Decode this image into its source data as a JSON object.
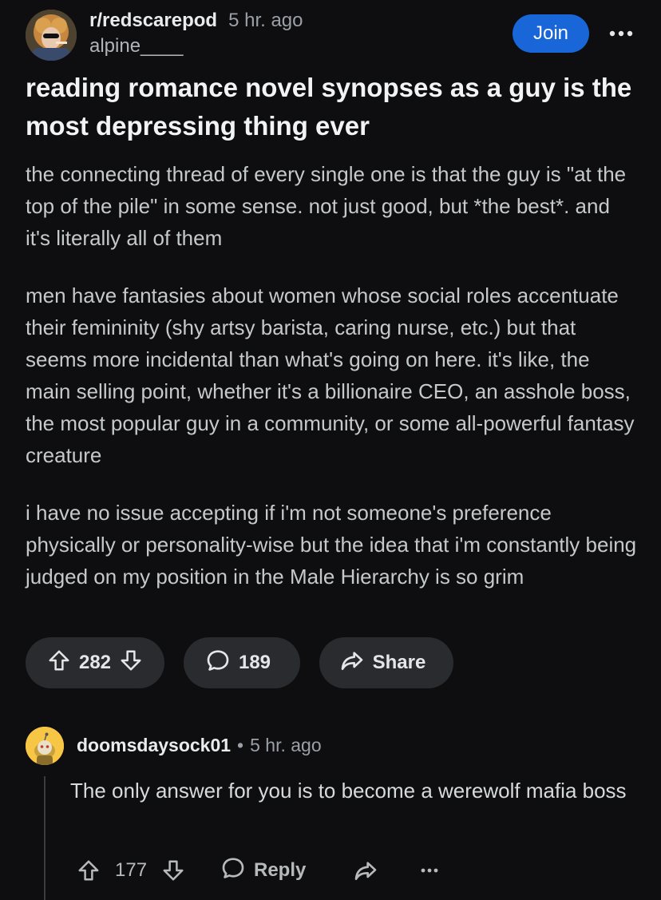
{
  "post": {
    "subreddit": "r/redscarepod",
    "time": "5 hr. ago",
    "username": "alpine____",
    "join_label": "Join",
    "title": "reading romance novel synopses as a guy is the most depressing thing ever",
    "paragraphs": [
      "the connecting thread of every single one is that the guy is \"at the top of the pile\" in some sense. not just good, but *the best*. and it's literally all of them",
      "men have fantasies about women whose social roles accentuate their femininity (shy artsy barista, caring nurse, etc.) but that seems more incidental than what's going on here. it's like, the main selling point, whether it's a billionaire CEO, an asshole boss, the most popular guy in a community, or some all-powerful fantasy creature",
      "i have no issue accepting if i'm not someone's preference physically or personality-wise but the idea that i'm constantly being judged on my position in the Male Hierarchy is so grim"
    ],
    "votes": "282",
    "comments": "189",
    "share_label": "Share"
  },
  "comment": {
    "username": "doomsdaysock01",
    "separator": "•",
    "time": "5 hr. ago",
    "text": "The only answer for you is to become a werewolf mafia boss",
    "votes": "177",
    "reply_label": "Reply"
  },
  "colors": {
    "background": "#0e0e10",
    "join_button": "#1866d8",
    "pill": "#2a2b2e"
  }
}
